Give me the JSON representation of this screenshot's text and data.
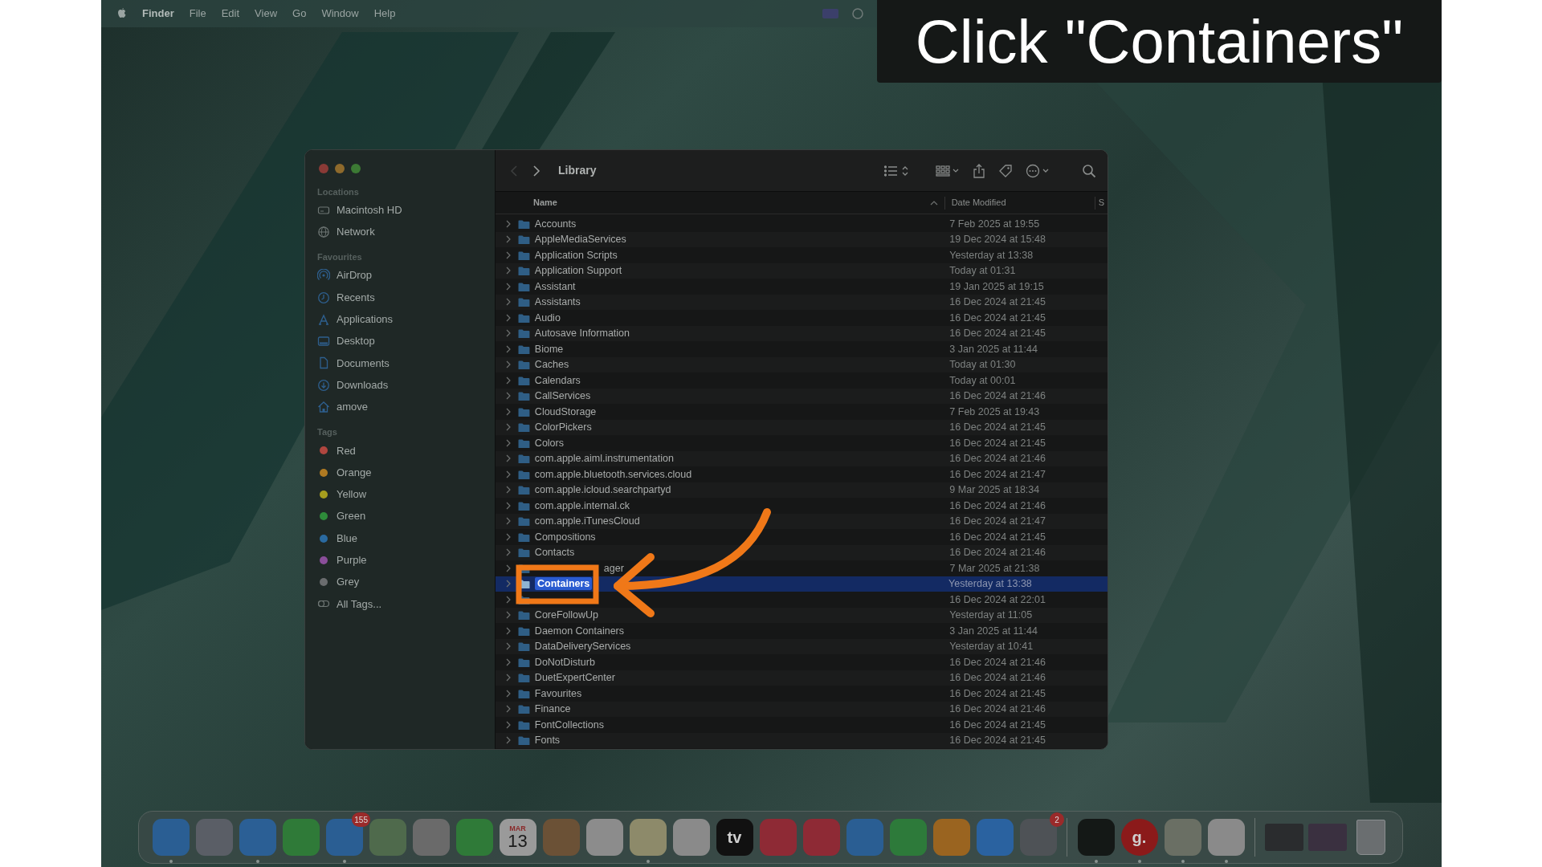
{
  "menu_bar": {
    "items": [
      {
        "label": "Finder",
        "bold": true
      },
      {
        "label": "File",
        "bold": false
      },
      {
        "label": "Edit",
        "bold": false
      },
      {
        "label": "View",
        "bold": false
      },
      {
        "label": "Go",
        "bold": false
      },
      {
        "label": "Window",
        "bold": false
      },
      {
        "label": "Help",
        "bold": false
      }
    ]
  },
  "annotation": {
    "caption": "Click \"Containers\""
  },
  "finder": {
    "toolbar": {
      "back": {
        "disabled": true
      },
      "title": "Library"
    },
    "sidebar": [
      {
        "heading": "Locations",
        "items": [
          {
            "label": "Macintosh HD",
            "kind": "disk"
          },
          {
            "label": "Network",
            "kind": "globe"
          }
        ]
      },
      {
        "heading": "Favourites",
        "items": [
          {
            "label": "AirDrop",
            "kind": "airdrop"
          },
          {
            "label": "Recents",
            "kind": "clock"
          },
          {
            "label": "Applications",
            "kind": "apps"
          },
          {
            "label": "Desktop",
            "kind": "desktop"
          },
          {
            "label": "Documents",
            "kind": "document"
          },
          {
            "label": "Downloads",
            "kind": "download"
          },
          {
            "label": "amove",
            "kind": "home"
          }
        ]
      },
      {
        "heading": "Tags",
        "items": [
          {
            "label": "Red",
            "kind": "tag",
            "color": "#b0463f"
          },
          {
            "label": "Orange",
            "kind": "tag",
            "color": "#b07a22"
          },
          {
            "label": "Yellow",
            "kind": "tag",
            "color": "#a59d1e"
          },
          {
            "label": "Green",
            "kind": "tag",
            "color": "#2e8b3a"
          },
          {
            "label": "Blue",
            "kind": "tag",
            "color": "#2a6aa0"
          },
          {
            "label": "Purple",
            "kind": "tag",
            "color": "#8a4e9a"
          },
          {
            "label": "Grey",
            "kind": "tag",
            "color": "#6a6c6e"
          },
          {
            "label": "All Tags...",
            "kind": "alltags"
          }
        ]
      }
    ],
    "columns": {
      "name": "Name",
      "date": "Date Modified",
      "column_3": "S"
    },
    "rows": [
      {
        "name": "Accounts",
        "date": "7 Feb 2025 at 19:55",
        "selected": false
      },
      {
        "name": "AppleMediaServices",
        "date": "19 Dec 2024 at 15:48",
        "selected": false
      },
      {
        "name": "Application Scripts",
        "date": "Yesterday at 13:38",
        "selected": false
      },
      {
        "name": "Application Support",
        "date": "Today at 01:31",
        "selected": false
      },
      {
        "name": "Assistant",
        "date": "19 Jan 2025 at 19:15",
        "selected": false
      },
      {
        "name": "Assistants",
        "date": "16 Dec 2024 at 21:45",
        "selected": false
      },
      {
        "name": "Audio",
        "date": "16 Dec 2024 at 21:45",
        "selected": false
      },
      {
        "name": "Autosave Information",
        "date": "16 Dec 2024 at 21:45",
        "selected": false
      },
      {
        "name": "Biome",
        "date": "3 Jan 2025 at 11:44",
        "selected": false
      },
      {
        "name": "Caches",
        "date": "Today at 01:30",
        "selected": false
      },
      {
        "name": "Calendars",
        "date": "Today at 00:01",
        "selected": false
      },
      {
        "name": "CallServices",
        "date": "16 Dec 2024 at 21:46",
        "selected": false
      },
      {
        "name": "CloudStorage",
        "date": "7 Feb 2025 at 19:43",
        "selected": false
      },
      {
        "name": "ColorPickers",
        "date": "16 Dec 2024 at 21:45",
        "selected": false
      },
      {
        "name": "Colors",
        "date": "16 Dec 2024 at 21:45",
        "selected": false
      },
      {
        "name": "com.apple.aiml.instrumentation",
        "date": "16 Dec 2024 at 21:46",
        "selected": false
      },
      {
        "name": "com.apple.bluetooth.services.cloud",
        "date": "16 Dec 2024 at 21:47",
        "selected": false
      },
      {
        "name": "com.apple.icloud.searchpartyd",
        "date": "9 Mar 2025 at 18:34",
        "selected": false
      },
      {
        "name": "com.apple.internal.ck",
        "date": "16 Dec 2024 at 21:46",
        "selected": false
      },
      {
        "name": "com.apple.iTunesCloud",
        "date": "16 Dec 2024 at 21:47",
        "selected": false
      },
      {
        "name": "Compositions",
        "date": "16 Dec 2024 at 21:45",
        "selected": false
      },
      {
        "name": "Contacts",
        "date": "16 Dec 2024 at 21:46",
        "selected": false
      },
      {
        "name_fragment": "ager",
        "date": "7 Mar 2025 at 21:38",
        "selected": false
      },
      {
        "name": "Containers",
        "date": "Yesterday at 13:38",
        "selected": true
      },
      {
        "date": "16 Dec 2024 at 22:01",
        "selected": false
      },
      {
        "name": "CoreFollowUp",
        "date": "Yesterday at 11:05",
        "selected": false
      },
      {
        "name": "Daemon Containers",
        "date": "3 Jan 2025 at 11:44",
        "selected": false
      },
      {
        "name": "DataDeliveryServices",
        "date": "Yesterday at 10:41",
        "selected": false
      },
      {
        "name": "DoNotDisturb",
        "date": "16 Dec 2024 at 21:46",
        "selected": false
      },
      {
        "name": "DuetExpertCenter",
        "date": "16 Dec 2024 at 21:46",
        "selected": false
      },
      {
        "name": "Favourites",
        "date": "16 Dec 2024 at 21:45",
        "selected": false
      },
      {
        "name": "Finance",
        "date": "16 Dec 2024 at 21:46",
        "selected": false
      },
      {
        "name": "FontCollections",
        "date": "16 Dec 2024 at 21:45",
        "selected": false
      },
      {
        "name": "Fonts",
        "date": "16 Dec 2024 at 21:45",
        "selected": false
      }
    ]
  },
  "dock": [
    {
      "kind": "app",
      "color": "#2a5e93",
      "running": true
    },
    {
      "kind": "app",
      "color": "#5a5e66",
      "running": false
    },
    {
      "kind": "app",
      "color": "#2b5f95",
      "running": true
    },
    {
      "kind": "app",
      "color": "#2f7a38",
      "running": false
    },
    {
      "kind": "app",
      "color": "#2a5e93",
      "running": true,
      "badge": "155"
    },
    {
      "kind": "app",
      "color": "#4f6a4c",
      "running": false
    },
    {
      "kind": "app",
      "color": "#6a6a6a",
      "running": false
    },
    {
      "kind": "app",
      "color": "#2f7a38",
      "running": false
    },
    {
      "kind": "calendar",
      "color": "#9a9a9a",
      "running": false,
      "month": "MAR",
      "day": "13"
    },
    {
      "kind": "app",
      "color": "#6b5136",
      "running": false
    },
    {
      "kind": "app",
      "color": "#8c8c8c",
      "running": false
    },
    {
      "kind": "app",
      "color": "#8d8a6a",
      "running": true
    },
    {
      "kind": "app",
      "color": "#8a8a8a",
      "running": false
    },
    {
      "kind": "text",
      "color": "#111111",
      "running": false,
      "label": "tv"
    },
    {
      "kind": "app",
      "color": "#8e2a35",
      "running": false
    },
    {
      "kind": "app",
      "color": "#8e2a35",
      "running": false
    },
    {
      "kind": "app",
      "color": "#2a5e93",
      "running": false
    },
    {
      "kind": "app",
      "color": "#2d7a3a",
      "running": false
    },
    {
      "kind": "app",
      "color": "#9a6420",
      "running": false
    },
    {
      "kind": "app",
      "color": "#2a62a0",
      "running": false
    },
    {
      "kind": "app",
      "color": "#4e5256",
      "running": false,
      "badge": "2"
    },
    {
      "kind": "separator"
    },
    {
      "kind": "app",
      "color": "#141816",
      "running": true
    },
    {
      "kind": "round",
      "color": "#8b1a1a",
      "running": true,
      "label": "g."
    },
    {
      "kind": "app",
      "color": "#6a6f64",
      "running": true
    },
    {
      "kind": "app",
      "color": "#8a8a8a",
      "running": true
    },
    {
      "kind": "separator"
    },
    {
      "kind": "window",
      "color": "#2a2c2e",
      "running": false
    },
    {
      "kind": "window",
      "color": "#3a3040",
      "running": false
    },
    {
      "kind": "trash",
      "color": "#6a6e70",
      "running": false
    }
  ]
}
